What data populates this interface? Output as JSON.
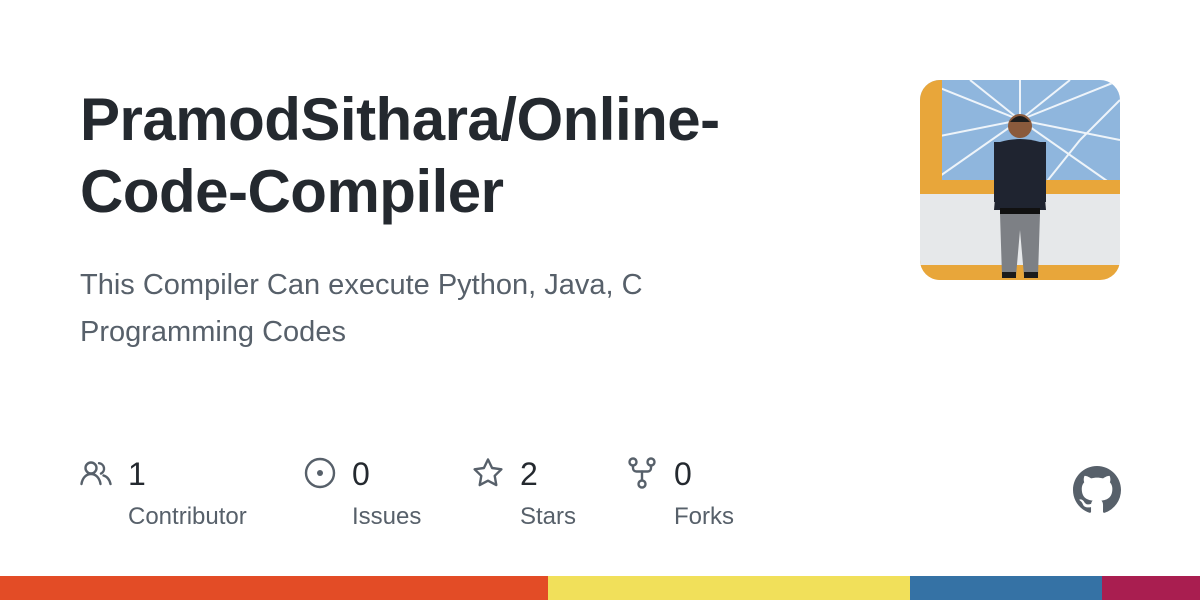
{
  "repo": {
    "owner_prefix": "PramodSithara/",
    "name": "Online-Code-Compiler",
    "description": "This Compiler Can execute Python, Java, C Programming Codes"
  },
  "avatar": {
    "icon": "avatar-photo"
  },
  "stats": [
    {
      "icon": "people-icon",
      "count": "1",
      "label": "Contributor"
    },
    {
      "icon": "issue-icon",
      "count": "0",
      "label": "Issues"
    },
    {
      "icon": "star-icon",
      "count": "2",
      "label": "Stars"
    },
    {
      "icon": "fork-icon",
      "count": "0",
      "label": "Forks"
    }
  ],
  "brand": {
    "icon": "github-logo-icon"
  },
  "languages": [
    {
      "color": "#e34c26",
      "share": 45.7
    },
    {
      "color": "#f1e05a",
      "share": 30.1
    },
    {
      "color": "#3572a5",
      "share": 16.0
    },
    {
      "color": "#a91e50",
      "share": 8.2
    }
  ],
  "colors": {
    "text_primary": "#24292f",
    "text_secondary": "#57606a",
    "icon": "#57606a"
  }
}
